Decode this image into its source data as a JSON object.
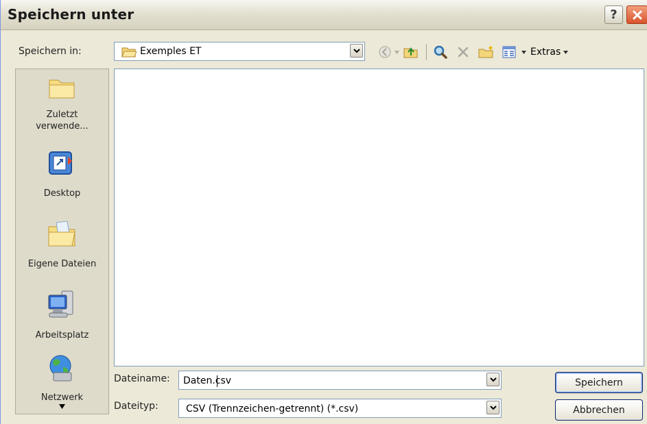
{
  "window": {
    "title": "Speichern unter",
    "help_glyph": "?"
  },
  "toolbar": {
    "save_in_label": "Speichern in:",
    "location": "Exemples ET",
    "extras_label": "Extras"
  },
  "places": [
    {
      "label_line1": "Zuletzt",
      "label_line2": "verwende..."
    },
    {
      "label_line1": "Desktop",
      "label_line2": ""
    },
    {
      "label_line1": "Eigene Dateien",
      "label_line2": ""
    },
    {
      "label_line1": "Arbeitsplatz",
      "label_line2": ""
    },
    {
      "label_line1": "Netzwerk",
      "label_line2": ""
    }
  ],
  "form": {
    "filename_label": "Dateiname:",
    "filename_value": "Daten.csv",
    "filetype_label": "Dateityp:",
    "filetype_value": "CSV (Trennzeichen-getrennt) (*.csv)"
  },
  "buttons": {
    "save": "Speichern",
    "cancel": "Abbrechen"
  },
  "colors": {
    "close_button": "#d8532b",
    "selection_border": "#0a246a",
    "dialog_face": "#ece9d8"
  }
}
